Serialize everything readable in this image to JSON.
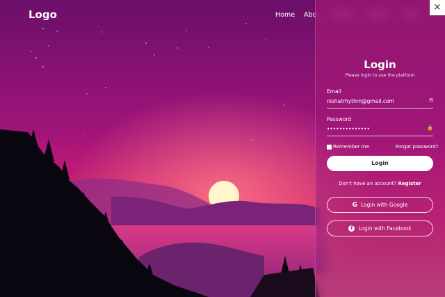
{
  "header": {
    "logo": "Logo",
    "nav": [
      "Home",
      "Abo"
    ]
  },
  "login": {
    "title": "Login",
    "subtitle": "Please login to use the platform",
    "email_label": "Email",
    "email_value": "nishatrhythm@gmail.com",
    "password_label": "Password",
    "password_value": "••••••••••••••",
    "remember_label": "Remember me",
    "forgot_label": "Forgot password?",
    "login_button": "Login",
    "no_account_text": "Don't have an account?",
    "register_link": "Register",
    "google_button": "Login with Google",
    "facebook_button": "Login with Facebook",
    "close_label": "×"
  },
  "colors": {
    "sky_top": "#6d0f6a",
    "sun_glow": "#e0236d",
    "sun": "#fff6c9",
    "panel": "#b01e76"
  },
  "icons": {
    "email": "envelope-icon",
    "password": "lock-icon",
    "google": "google-icon",
    "facebook": "facebook-icon"
  }
}
